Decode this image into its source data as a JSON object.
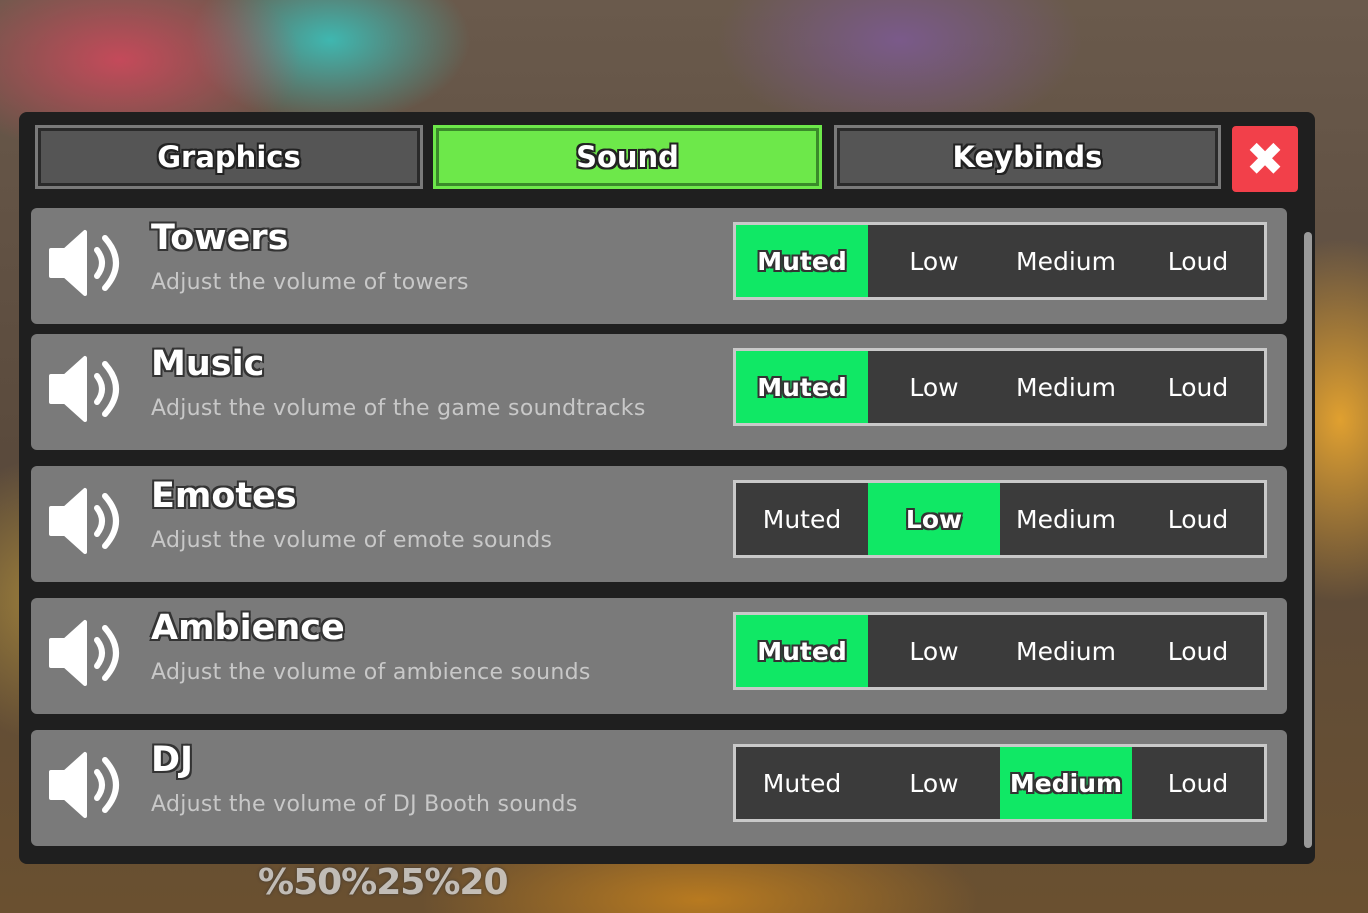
{
  "background_text": "%50%25%20",
  "tabs": [
    {
      "label": "Graphics",
      "active": false
    },
    {
      "label": "Sound",
      "active": true
    },
    {
      "label": "Keybinds",
      "active": false
    }
  ],
  "close_symbol": "✖",
  "colors": {
    "tab_active": "#6de84a",
    "option_selected": "#10e865",
    "close_button": "#f2404a",
    "row_bg": "#7a7a7a",
    "panel_bg": "#1f1f1f"
  },
  "option_labels": [
    "Muted",
    "Low",
    "Medium",
    "Loud"
  ],
  "settings": [
    {
      "title": "Towers",
      "description": "Adjust the volume of towers",
      "icon": "speaker-icon",
      "selected": "Muted"
    },
    {
      "title": "Music",
      "description": "Adjust the volume of the game soundtracks",
      "icon": "speaker-icon",
      "selected": "Muted"
    },
    {
      "title": "Emotes",
      "description": "Adjust the volume of emote sounds",
      "icon": "speaker-icon",
      "selected": "Low"
    },
    {
      "title": "Ambience",
      "description": "Adjust the volume of ambience sounds",
      "icon": "speaker-icon",
      "selected": "Muted"
    },
    {
      "title": "DJ",
      "description": "Adjust the volume of DJ Booth sounds",
      "icon": "speaker-icon",
      "selected": "Medium"
    }
  ]
}
